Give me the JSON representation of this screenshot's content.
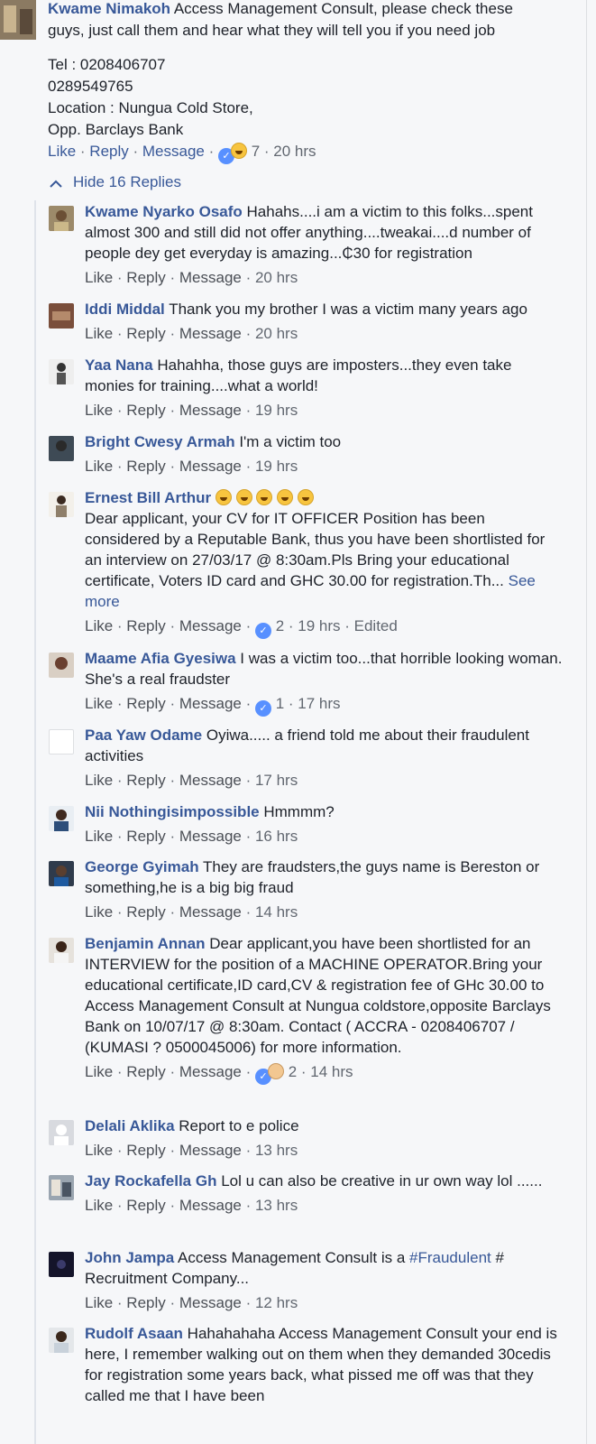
{
  "top_comment": {
    "author": "Kwame Nimakoh",
    "text_line1": " Access Management Consult, please check these",
    "text_line2": "guys, just call them and hear what they will tell you if you need job",
    "info": [
      "Tel : 0208406707",
      "0289549765",
      "Location : Nungua Cold Store,",
      "Opp. Barclays Bank"
    ],
    "actions": {
      "like": "Like",
      "reply": "Reply",
      "message": "Message",
      "reactions": "7",
      "time": "20 hrs"
    }
  },
  "hide_replies": "Hide 16 Replies",
  "replies": [
    {
      "author": "Kwame Nyarko Osafo",
      "text": "Hahahs....i am a victim to this folks...spent almost 300 and still did not offer anything....tweakai....d number of people dey get everyday is amazing...₵30 for registration",
      "time": "20 hrs"
    },
    {
      "author": "Iddi Middal",
      "text": "Thank you my brother I was a victim many years ago",
      "time": "20 hrs"
    },
    {
      "author": "Yaa Nana",
      "text": "Hahahha, those guys are imposters...they even take monies for training....what a world!",
      "time": "19 hrs"
    },
    {
      "author": "Bright Cwesy Armah",
      "text": "I'm a victim too",
      "time": "19 hrs"
    },
    {
      "author": "Ernest Bill Arthur",
      "text": "Dear applicant, your CV for IT OFFICER Position has been considered by a Reputable Bank, thus you have been shortlisted for an interview on 27/03/17 @ 8:30am.Pls Bring your educational certificate, Voters ID card and GHC 30.00 for registration.Th...",
      "see_more": "See more",
      "reactions": "2",
      "time": "19 hrs",
      "edited": "Edited"
    },
    {
      "author": "Maame Afia Gyesiwa",
      "text": "I was a victim too...that horrible looking woman. She's a real fraudster",
      "reactions": "1",
      "time": "17 hrs"
    },
    {
      "author": "Paa Yaw Odame",
      "text": "Oyiwa..... a friend told me about their fraudulent activities",
      "time": "17 hrs"
    },
    {
      "author": "Nii Nothingisimpossible",
      "text": "Hmmmm?",
      "time": "16 hrs"
    },
    {
      "author": "George Gyimah",
      "text": "They are fraudsters,the guys name is Bereston or something,he is a big big fraud",
      "time": "14 hrs"
    },
    {
      "author": "Benjamin Annan",
      "text": "Dear applicant,you have been shortlisted for an INTERVIEW for the position of a MACHINE OPERATOR.Bring your educational certificate,ID card,CV & registration fee of GHc 30.00 to Access Management Consult at Nungua coldstore,opposite Barclays Bank on 10/07/17 @ 8:30am. Contact ( ACCRA - 0208406707 / (KUMASI ? 0500045006) for more information.",
      "reactions": "2",
      "time": "14 hrs"
    },
    {
      "author": "Delali Aklika",
      "text": "Report to e police",
      "time": "13 hrs"
    },
    {
      "author": "Jay Rockafella Gh",
      "text": "Lol u can also be creative in ur own way lol ......",
      "time": "13 hrs"
    },
    {
      "author": "John Jampa",
      "text_a": "Access Management Consult is a ",
      "hashtag": "#Fraudulent",
      "text_b": " # Recruitment Company...",
      "time": "12 hrs"
    },
    {
      "author": "Rudolf Asaan",
      "text": "Hahahahaha Access Management Consult your end is here, I remember walking out on them when they demanded 30cedis for registration some years back, what pissed me off was that they called me that I have been"
    }
  ],
  "labels": {
    "like": "Like",
    "reply": "Reply",
    "message": "Message",
    "dot": " · "
  },
  "colors": {
    "name": "#385898",
    "action": "#4b4f56",
    "background": "#f6f7f9",
    "like_icon": "#5890ff"
  }
}
